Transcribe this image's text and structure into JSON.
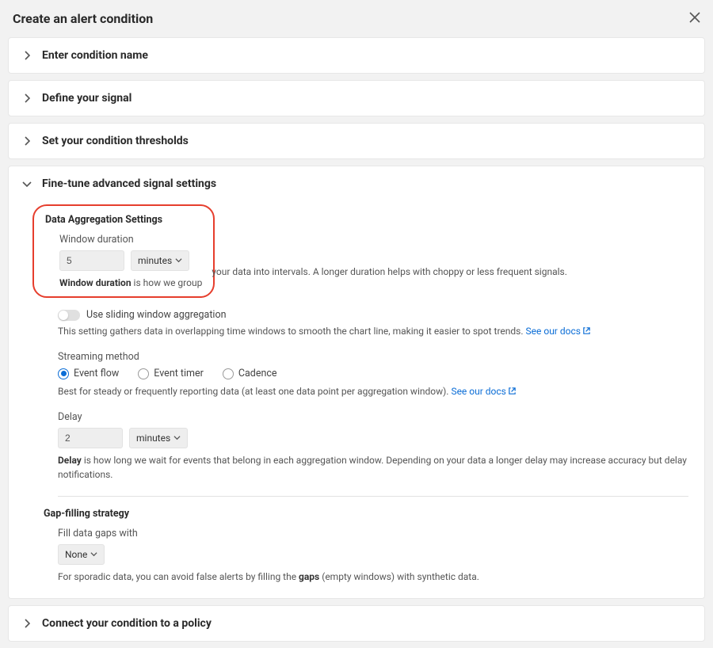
{
  "header": {
    "title": "Create an alert condition"
  },
  "sections": {
    "enter_name": {
      "title": "Enter condition name"
    },
    "define_signal": {
      "title": "Define your signal"
    },
    "thresholds": {
      "title": "Set your condition thresholds"
    },
    "fine_tune": {
      "title": "Fine-tune advanced signal settings",
      "data_agg_heading": "Data Aggregation Settings",
      "window_duration_label": "Window duration",
      "window_duration_value": "5",
      "window_duration_unit": "minutes",
      "window_duration_desc_bold": "Window duration",
      "window_duration_desc_inner": " is how we group ",
      "window_duration_desc_rest": "your data into intervals. A longer duration helps with choppy or less frequent signals.",
      "sliding_label": "Use sliding window aggregation",
      "sliding_desc": "This setting gathers data in overlapping time windows to smooth the chart line, making it easier to spot trends. ",
      "see_docs": "See our docs",
      "streaming_label": "Streaming method",
      "streaming_options": {
        "event_flow": "Event flow",
        "event_timer": "Event timer",
        "cadence": "Cadence"
      },
      "streaming_desc": "Best for steady or frequently reporting data (at least one data point per aggregation window). ",
      "delay_label": "Delay",
      "delay_value": "2",
      "delay_unit": "minutes",
      "delay_desc_bold": "Delay",
      "delay_desc_rest": " is how long we wait for events that belong in each aggregation window. Depending on your data a longer delay may increase accuracy but delay notifications.",
      "gap_heading": "Gap-filling strategy",
      "gap_label": "Fill data gaps with",
      "gap_value": "None",
      "gap_desc_pre": "For sporadic data, you can avoid false alerts by filling the ",
      "gap_desc_bold": "gaps",
      "gap_desc_post": " (empty windows) with synthetic data."
    },
    "connect": {
      "title": "Connect your condition to a policy"
    }
  }
}
